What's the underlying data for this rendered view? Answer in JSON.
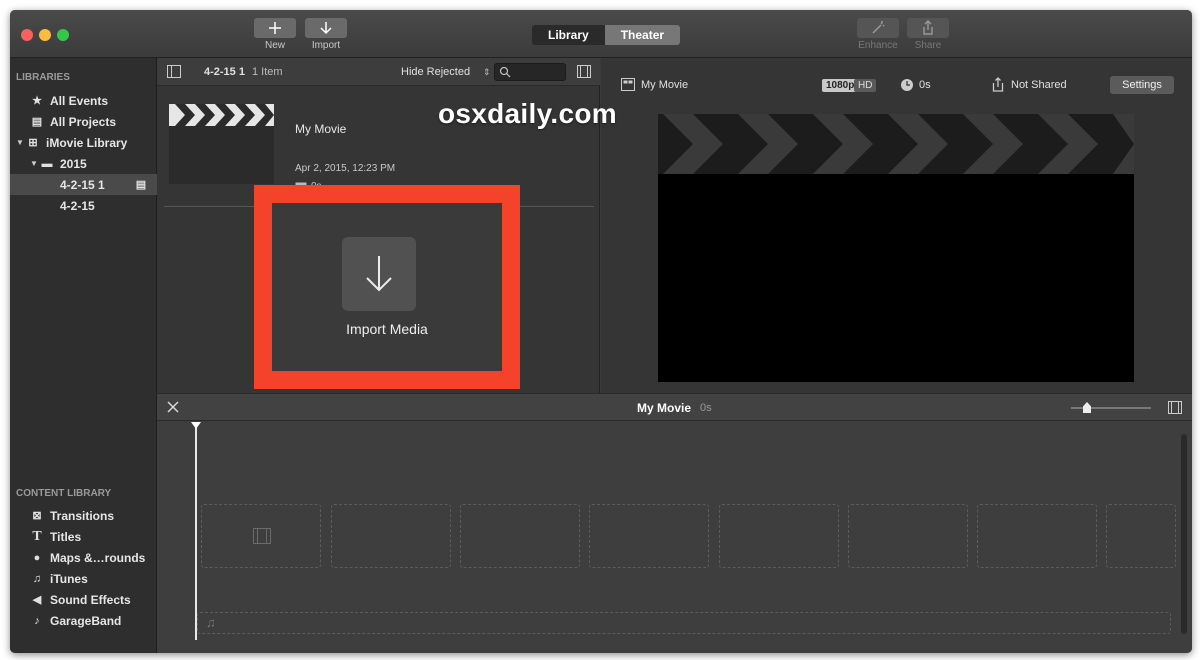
{
  "toolbar": {
    "new_label": "New",
    "import_label": "Import",
    "library_tab": "Library",
    "theater_tab": "Theater",
    "enhance_label": "Enhance",
    "share_label": "Share"
  },
  "sidebar": {
    "libraries_heading": "LIBRARIES",
    "items": [
      {
        "label": "All Events",
        "icon": "star-icon"
      },
      {
        "label": "All Projects",
        "icon": "clapper-icon"
      },
      {
        "label": "iMovie Library",
        "icon": "grid-icon"
      },
      {
        "label": "2015",
        "icon": "folder-icon"
      },
      {
        "label": "4-2-15 1",
        "icon": "clapper-icon"
      },
      {
        "label": "4-2-15",
        "icon": ""
      }
    ],
    "content_heading": "CONTENT LIBRARY",
    "content_items": [
      {
        "label": "Transitions",
        "icon": "transitions-icon"
      },
      {
        "label": "Titles",
        "icon": "titles-icon"
      },
      {
        "label": "Maps &…rounds",
        "icon": "globe-icon"
      },
      {
        "label": "iTunes",
        "icon": "music-note-icon"
      },
      {
        "label": "Sound Effects",
        "icon": "speaker-icon"
      },
      {
        "label": "GarageBand",
        "icon": "guitar-icon"
      }
    ]
  },
  "browser": {
    "event_name": "4-2-15 1",
    "item_count": "1 Item",
    "filter": "Hide Rejected",
    "clip_title": "My Movie",
    "clip_date": "Apr 2, 2015, 12:23 PM",
    "clip_duration": "0s"
  },
  "import_panel": {
    "label": "Import Media",
    "highlight_color": "#f4432a"
  },
  "viewer": {
    "title": "My Movie",
    "resolution": "1080p",
    "hd": "HD",
    "duration": "0s",
    "share_status": "Not Shared",
    "settings_label": "Settings"
  },
  "timeline": {
    "title": "My Movie",
    "duration": "0s"
  },
  "watermark": "osxdaily.com"
}
